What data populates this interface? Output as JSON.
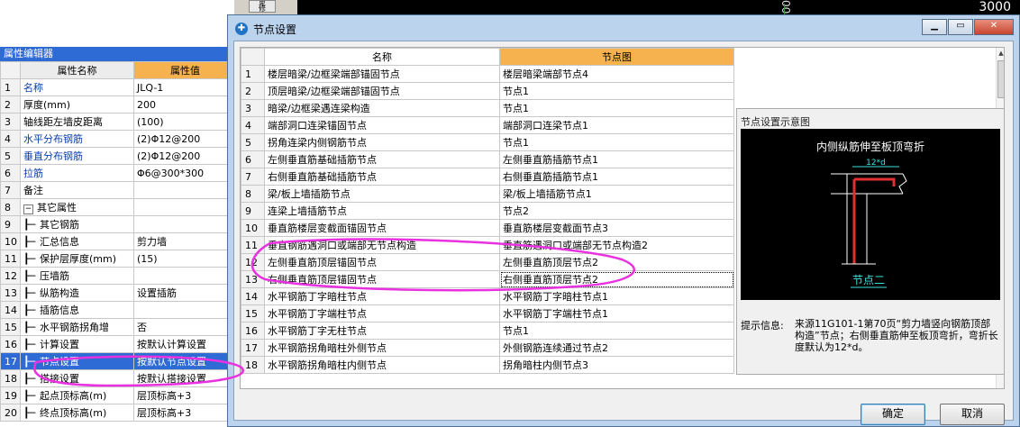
{
  "background": {
    "corner_number": "3000",
    "vertical_number": "00",
    "small_button": "卑\n修"
  },
  "prop_editor": {
    "title": "属性编辑器",
    "col_name": "属性名称",
    "col_value": "属性值",
    "rows": [
      {
        "n": "1",
        "name": "名称",
        "value": "JLQ-1",
        "blue": true,
        "indent": 0
      },
      {
        "n": "2",
        "name": "厚度(mm)",
        "value": "200",
        "blue": false,
        "indent": 0
      },
      {
        "n": "3",
        "name": "轴线距左墙皮距离",
        "value": "(100)",
        "blue": false,
        "indent": 0
      },
      {
        "n": "4",
        "name": "水平分布钢筋",
        "value": "(2)Φ12@200",
        "blue": true,
        "indent": 0
      },
      {
        "n": "5",
        "name": "垂直分布钢筋",
        "value": "(2)Φ12@200",
        "blue": true,
        "indent": 0
      },
      {
        "n": "6",
        "name": "拉筋",
        "value": "Φ6@300*300",
        "blue": true,
        "indent": 0
      },
      {
        "n": "7",
        "name": "备注",
        "value": "",
        "blue": false,
        "indent": 0
      },
      {
        "n": "8",
        "name": "其它属性",
        "value": "",
        "blue": false,
        "indent": -1
      },
      {
        "n": "9",
        "name": "其它钢筋",
        "value": "",
        "blue": false,
        "indent": 1
      },
      {
        "n": "10",
        "name": "汇总信息",
        "value": "剪力墙",
        "blue": false,
        "indent": 1
      },
      {
        "n": "11",
        "name": "保护层厚度(mm)",
        "value": "(15)",
        "blue": false,
        "indent": 1
      },
      {
        "n": "12",
        "name": "压墙筋",
        "value": "",
        "blue": false,
        "indent": 1
      },
      {
        "n": "13",
        "name": "纵筋构造",
        "value": "设置插筋",
        "blue": false,
        "indent": 1
      },
      {
        "n": "14",
        "name": "插筋信息",
        "value": "",
        "blue": false,
        "indent": 1
      },
      {
        "n": "15",
        "name": "水平钢筋拐角增",
        "value": "否",
        "blue": false,
        "indent": 1
      },
      {
        "n": "16",
        "name": "计算设置",
        "value": "按默认计算设置",
        "blue": false,
        "indent": 1
      },
      {
        "n": "17",
        "name": "节点设置",
        "value": "按默认节点设置",
        "blue": false,
        "indent": 1,
        "selected": true
      },
      {
        "n": "18",
        "name": "搭接设置",
        "value": "按默认搭接设置",
        "blue": false,
        "indent": 1
      },
      {
        "n": "19",
        "name": "起点顶标高(m)",
        "value": "层顶标高+3",
        "blue": false,
        "indent": 1
      },
      {
        "n": "20",
        "name": "终点顶标高(m)",
        "value": "层顶标高+3",
        "blue": false,
        "indent": 1
      }
    ]
  },
  "dialog": {
    "title": "节点设置",
    "col_name": "名称",
    "col_node": "节点图",
    "rows": [
      {
        "n": "1",
        "name": "楼层暗梁/边框梁端部锚固节点",
        "node": "楼层暗梁端部节点4"
      },
      {
        "n": "2",
        "name": "顶层暗梁/边框梁端部锚固节点",
        "node": "节点1"
      },
      {
        "n": "3",
        "name": "暗梁/边框梁遇连梁构造",
        "node": "节点1"
      },
      {
        "n": "4",
        "name": "端部洞口连梁锚固节点",
        "node": "端部洞口连梁节点1"
      },
      {
        "n": "5",
        "name": "拐角连梁内侧钢筋节点",
        "node": "节点1"
      },
      {
        "n": "6",
        "name": "左侧垂直筋基础插筋节点",
        "node": "左侧垂直筋插筋节点1"
      },
      {
        "n": "7",
        "name": "右侧垂直筋基础插筋节点",
        "node": "右侧垂直筋插筋节点1"
      },
      {
        "n": "8",
        "name": "梁/板上墙插筋节点",
        "node": "梁/板上墙插筋节点1"
      },
      {
        "n": "9",
        "name": "连梁上墙插筋节点",
        "node": "节点2"
      },
      {
        "n": "10",
        "name": "垂直筋楼层变截面锚固节点",
        "node": "垂直筋楼层变截面节点3"
      },
      {
        "n": "11",
        "name": "垂直钢筋遇洞口或端部无节点构造",
        "node": "垂直筋遇洞口或端部无节点构造2"
      },
      {
        "n": "12",
        "name": "左侧垂直筋顶层锚固节点",
        "node": "左侧垂直筋顶层节点2"
      },
      {
        "n": "13",
        "name": "右侧垂直筋顶层锚固节点",
        "node": "右侧垂直筋顶层节点2",
        "selected": true
      },
      {
        "n": "14",
        "name": "水平钢筋丁字暗柱节点",
        "node": "水平钢筋丁字暗柱节点1"
      },
      {
        "n": "15",
        "name": "水平钢筋丁字端柱节点",
        "node": "水平钢筋丁字端柱节点1"
      },
      {
        "n": "16",
        "name": "水平钢筋丁字无柱节点",
        "node": "节点1"
      },
      {
        "n": "17",
        "name": "水平钢筋拐角暗柱外侧节点",
        "node": "外侧钢筋连续通过节点2"
      },
      {
        "n": "18",
        "name": "水平钢筋拐角暗柱内侧节点",
        "node": "拐角暗柱内侧节点3"
      }
    ],
    "schematic": {
      "title": "节点设置示意图",
      "caption": "内侧纵筋伸至板顶弯折",
      "dim": "12*d",
      "label": "节点二"
    },
    "hint_label": "提示信息:",
    "hint_text": "来源11G101-1第70页“剪力墙竖向钢筋顶部构造”节点；右侧垂直筋伸至板顶弯折，弯折长度默认为12*d。",
    "ok": "确定",
    "cancel": "取消"
  },
  "colors": {
    "selection": "#2f6bd4",
    "header_accent": "#f5b24e",
    "annotation": "#e832e0"
  }
}
